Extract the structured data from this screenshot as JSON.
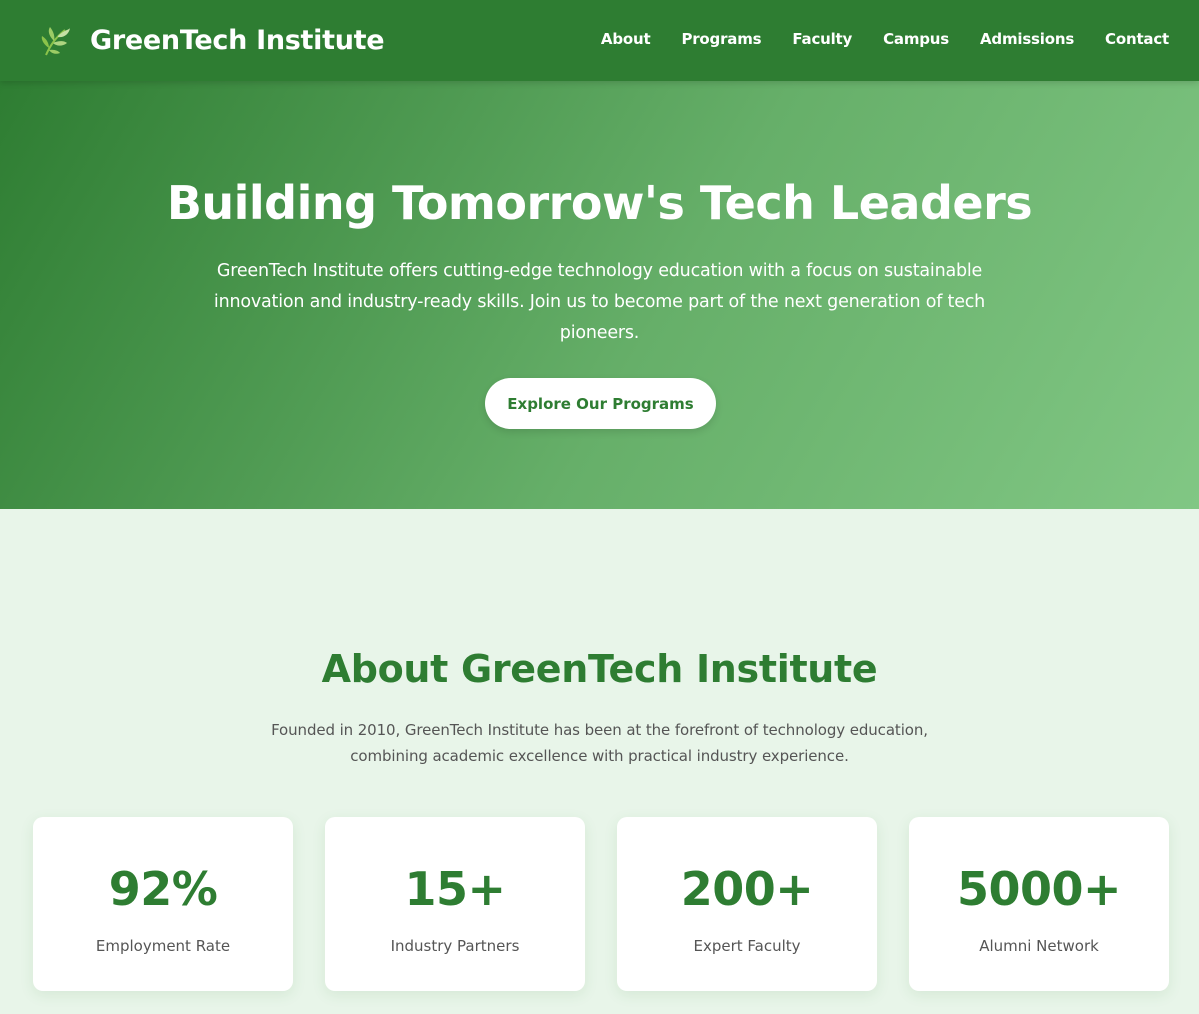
{
  "header": {
    "brand": "GreenTech Institute",
    "logo_icon": "leaf-icon",
    "nav": [
      "About",
      "Programs",
      "Faculty",
      "Campus",
      "Admissions",
      "Contact"
    ]
  },
  "hero": {
    "title": "Building Tomorrow's Tech Leaders",
    "text": "GreenTech Institute offers cutting-edge technology education with a focus on sustainable innovation and industry-ready skills. Join us to become part of the next generation of tech pioneers.",
    "cta": "Explore Our Programs"
  },
  "about": {
    "title": "About GreenTech Institute",
    "text": "Founded in 2010, GreenTech Institute has been at the forefront of technology education, combining academic excellence with practical industry experience.",
    "stats": [
      {
        "number": "92%",
        "label": "Employment Rate"
      },
      {
        "number": "15+",
        "label": "Industry Partners"
      },
      {
        "number": "200+",
        "label": "Expert Faculty"
      },
      {
        "number": "5000+",
        "label": "Alumni Network"
      }
    ]
  },
  "colors": {
    "primary": "#2e7d32",
    "light": "#81c784",
    "background": "#e8f5e9",
    "text_muted": "#555555"
  }
}
